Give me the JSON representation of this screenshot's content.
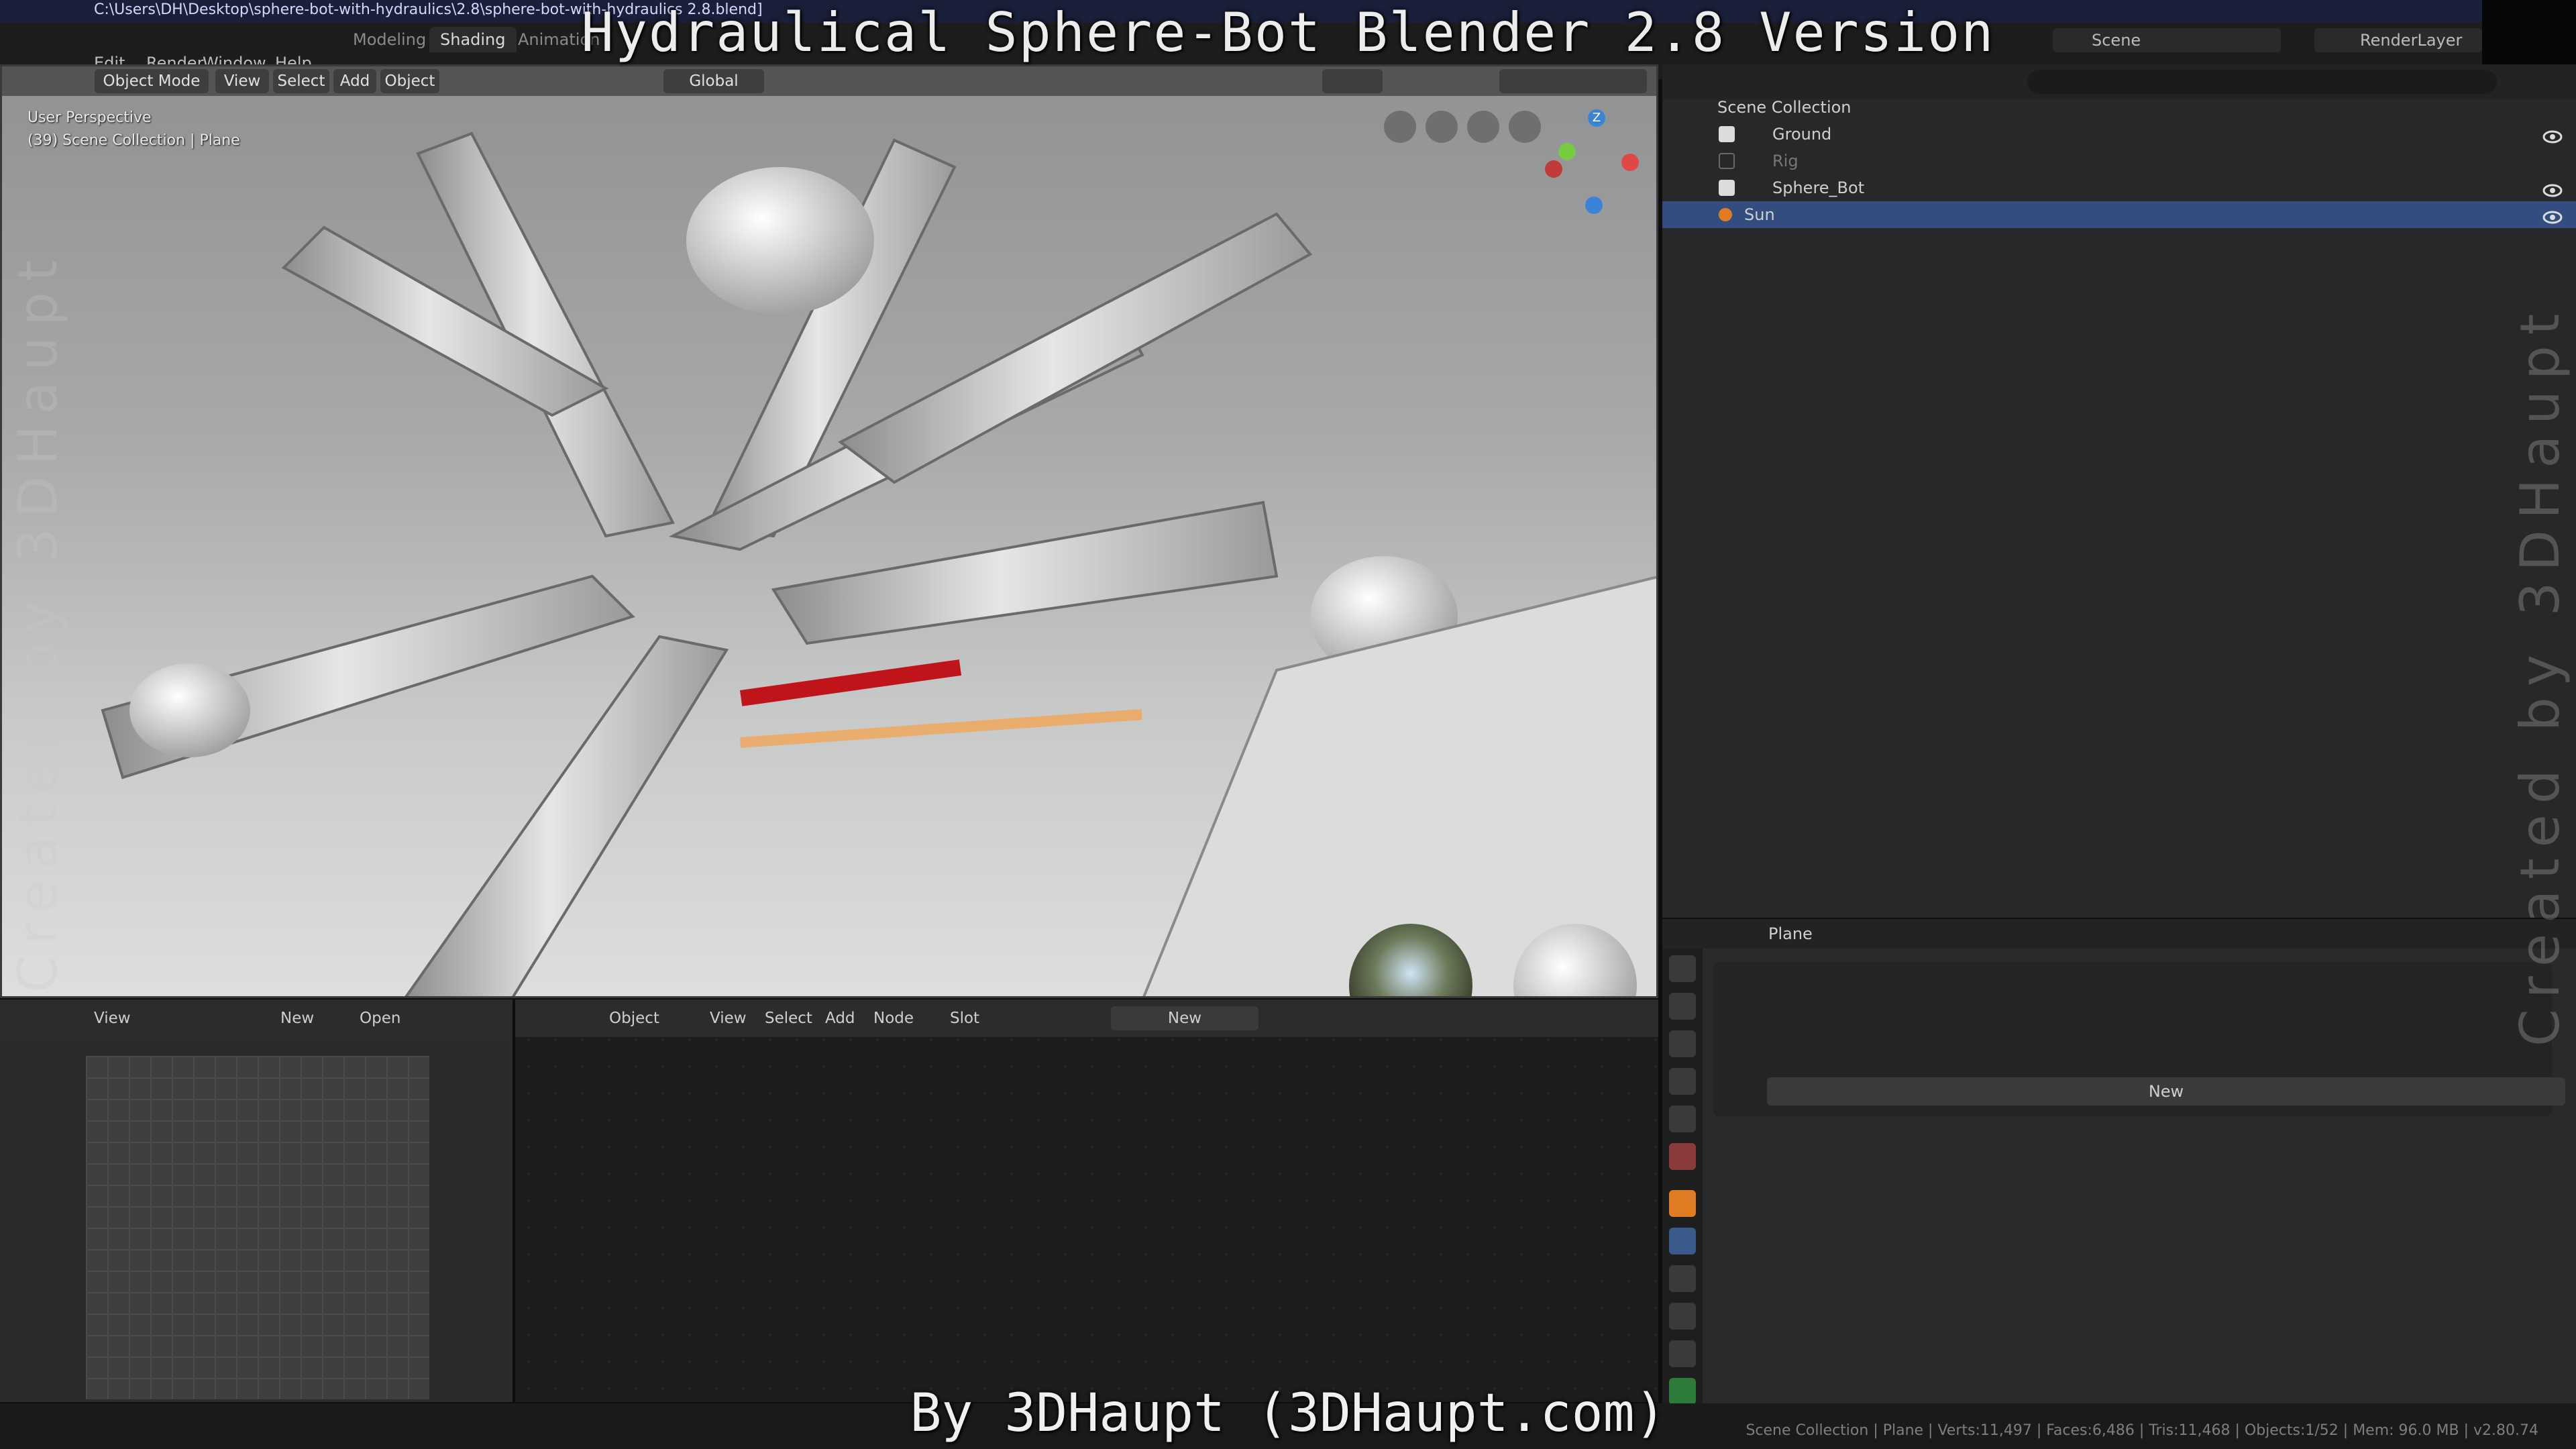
{
  "window": {
    "title_path": "C:\\Users\\DH\\Desktop\\sphere-bot-with-hydraulics\\2.8\\sphere-bot-with-hydraulics 2.8.blend]"
  },
  "overlay": {
    "title": "Hydraulical Sphere-Bot Blender 2.8 Version",
    "credit": "By 3DHaupt (3DHaupt.com)",
    "watermark": "Created by 3DHaupt"
  },
  "menu": [
    "Edit",
    "Render",
    "Window",
    "Help"
  ],
  "workspaces": [
    {
      "label": "Modeling",
      "active": false
    },
    {
      "label": "Shading",
      "active": true
    },
    {
      "label": "Animation",
      "active": false
    }
  ],
  "top_right": {
    "scene": "Scene",
    "render_layer": "RenderLayer"
  },
  "viewport": {
    "mode": "Object Mode",
    "menus": [
      "View",
      "Select",
      "Add",
      "Object"
    ],
    "orientation": "Global",
    "info_line1": "User Perspective",
    "info_line2": "(39) Scene Collection | Plane",
    "axes": {
      "z": "Z"
    }
  },
  "outliner": {
    "root": "Scene Collection",
    "items": [
      {
        "name": "Ground",
        "checked": true,
        "visible": true,
        "selected": false
      },
      {
        "name": "Rig",
        "checked": false,
        "visible": false,
        "selected": false
      },
      {
        "name": "Sphere_Bot",
        "checked": true,
        "visible": true,
        "selected": false
      },
      {
        "name": "Sun",
        "checked": null,
        "visible": true,
        "selected": true
      }
    ]
  },
  "properties": {
    "object_name": "Plane",
    "new_button": "New"
  },
  "image_editor": {
    "view": "View",
    "new": "New",
    "open": "Open"
  },
  "node_editor": {
    "object": "Object",
    "menus": [
      "View",
      "Select",
      "Add",
      "Node"
    ],
    "slot": "Slot",
    "new": "New"
  },
  "status": "Scene Collection | Plane | Verts:11,497 | Faces:6,486 | Tris:11,468 | Objects:1/52 | Mem: 96.0 MB | v2.80.74",
  "colors": {
    "selection": "#334d80",
    "accent_orange": "#e07b24",
    "blue_gizmo": "#3a84d8"
  }
}
